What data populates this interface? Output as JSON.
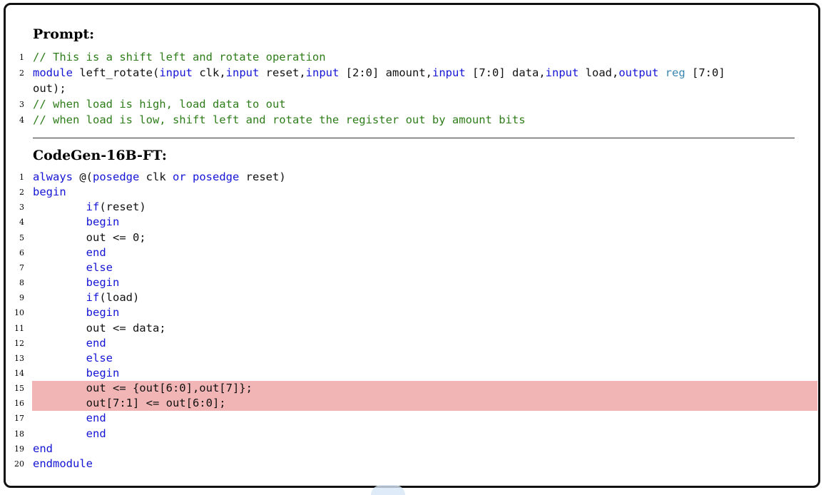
{
  "prompt": {
    "title": "Prompt:",
    "lines": [
      {
        "num": "1",
        "tokens": [
          {
            "t": "// This is a shift left and rotate operation",
            "k": "cm"
          }
        ]
      },
      {
        "num": "2",
        "tokens": [
          {
            "t": "module",
            "k": "kw"
          },
          {
            "t": " left_rotate(",
            "k": ""
          },
          {
            "t": "input",
            "k": "kw"
          },
          {
            "t": " clk,",
            "k": ""
          },
          {
            "t": "input",
            "k": "kw"
          },
          {
            "t": " reset,",
            "k": ""
          },
          {
            "t": "input",
            "k": "kw"
          },
          {
            "t": " [2:0] amount,",
            "k": ""
          },
          {
            "t": "input",
            "k": "kw"
          },
          {
            "t": " [7:0] data,",
            "k": ""
          },
          {
            "t": "input",
            "k": "kw"
          },
          {
            "t": " load,",
            "k": ""
          },
          {
            "t": "output",
            "k": "kw"
          },
          {
            "t": " ",
            "k": ""
          },
          {
            "t": "reg",
            "k": "ty"
          },
          {
            "t": " [7:0]",
            "k": ""
          }
        ]
      },
      {
        "num": "",
        "tokens": [
          {
            "t": "out);",
            "k": ""
          }
        ]
      },
      {
        "num": "3",
        "tokens": [
          {
            "t": "// when load is high, load data to out",
            "k": "cm"
          }
        ]
      },
      {
        "num": "4",
        "tokens": [
          {
            "t": "// when load is low, shift left and rotate the register out by amount bits",
            "k": "cm"
          }
        ]
      }
    ]
  },
  "completion": {
    "title": "CodeGen-16B-FT:",
    "lines": [
      {
        "num": "1",
        "tokens": [
          {
            "t": "always",
            "k": "kw"
          },
          {
            "t": " @(",
            "k": ""
          },
          {
            "t": "posedge",
            "k": "kw"
          },
          {
            "t": " clk ",
            "k": ""
          },
          {
            "t": "or",
            "k": "kw"
          },
          {
            "t": " ",
            "k": ""
          },
          {
            "t": "posedge",
            "k": "kw"
          },
          {
            "t": " reset)",
            "k": ""
          }
        ]
      },
      {
        "num": "2",
        "tokens": [
          {
            "t": "begin",
            "k": "kw"
          }
        ]
      },
      {
        "num": "3",
        "tokens": [
          {
            "t": "        ",
            "k": ""
          },
          {
            "t": "if",
            "k": "kw"
          },
          {
            "t": "(reset)",
            "k": ""
          }
        ]
      },
      {
        "num": "4",
        "tokens": [
          {
            "t": "        ",
            "k": ""
          },
          {
            "t": "begin",
            "k": "kw"
          }
        ]
      },
      {
        "num": "5",
        "tokens": [
          {
            "t": "        out <= 0;",
            "k": ""
          }
        ]
      },
      {
        "num": "6",
        "tokens": [
          {
            "t": "        ",
            "k": ""
          },
          {
            "t": "end",
            "k": "kw"
          }
        ]
      },
      {
        "num": "7",
        "tokens": [
          {
            "t": "        ",
            "k": ""
          },
          {
            "t": "else",
            "k": "kw"
          }
        ]
      },
      {
        "num": "8",
        "tokens": [
          {
            "t": "        ",
            "k": ""
          },
          {
            "t": "begin",
            "k": "kw"
          }
        ]
      },
      {
        "num": "9",
        "tokens": [
          {
            "t": "        ",
            "k": ""
          },
          {
            "t": "if",
            "k": "kw"
          },
          {
            "t": "(load)",
            "k": ""
          }
        ]
      },
      {
        "num": "10",
        "tokens": [
          {
            "t": "        ",
            "k": ""
          },
          {
            "t": "begin",
            "k": "kw"
          }
        ]
      },
      {
        "num": "11",
        "tokens": [
          {
            "t": "        out <= data;",
            "k": ""
          }
        ]
      },
      {
        "num": "12",
        "tokens": [
          {
            "t": "        ",
            "k": ""
          },
          {
            "t": "end",
            "k": "kw"
          }
        ]
      },
      {
        "num": "13",
        "tokens": [
          {
            "t": "        ",
            "k": ""
          },
          {
            "t": "else",
            "k": "kw"
          }
        ]
      },
      {
        "num": "14",
        "tokens": [
          {
            "t": "        ",
            "k": ""
          },
          {
            "t": "begin",
            "k": "kw"
          }
        ]
      },
      {
        "num": "15",
        "highlight": true,
        "tokens": [
          {
            "t": "        out <= {out[6:0],out[7]};",
            "k": ""
          }
        ]
      },
      {
        "num": "16",
        "highlight": true,
        "tokens": [
          {
            "t": "        out[7:1] <= out[6:0];",
            "k": ""
          }
        ]
      },
      {
        "num": "17",
        "tokens": [
          {
            "t": "        ",
            "k": ""
          },
          {
            "t": "end",
            "k": "kw"
          }
        ]
      },
      {
        "num": "18",
        "tokens": [
          {
            "t": "        ",
            "k": ""
          },
          {
            "t": "end",
            "k": "kw"
          }
        ]
      },
      {
        "num": "19",
        "tokens": [
          {
            "t": "end",
            "k": "kw"
          }
        ]
      },
      {
        "num": "20",
        "tokens": [
          {
            "t": "endmodule",
            "k": "kw"
          }
        ]
      }
    ]
  },
  "colors": {
    "keyword": "#1515d6",
    "comment": "#2e7d1a",
    "type": "#3a86b0",
    "highlight": "#f2b5b5"
  }
}
